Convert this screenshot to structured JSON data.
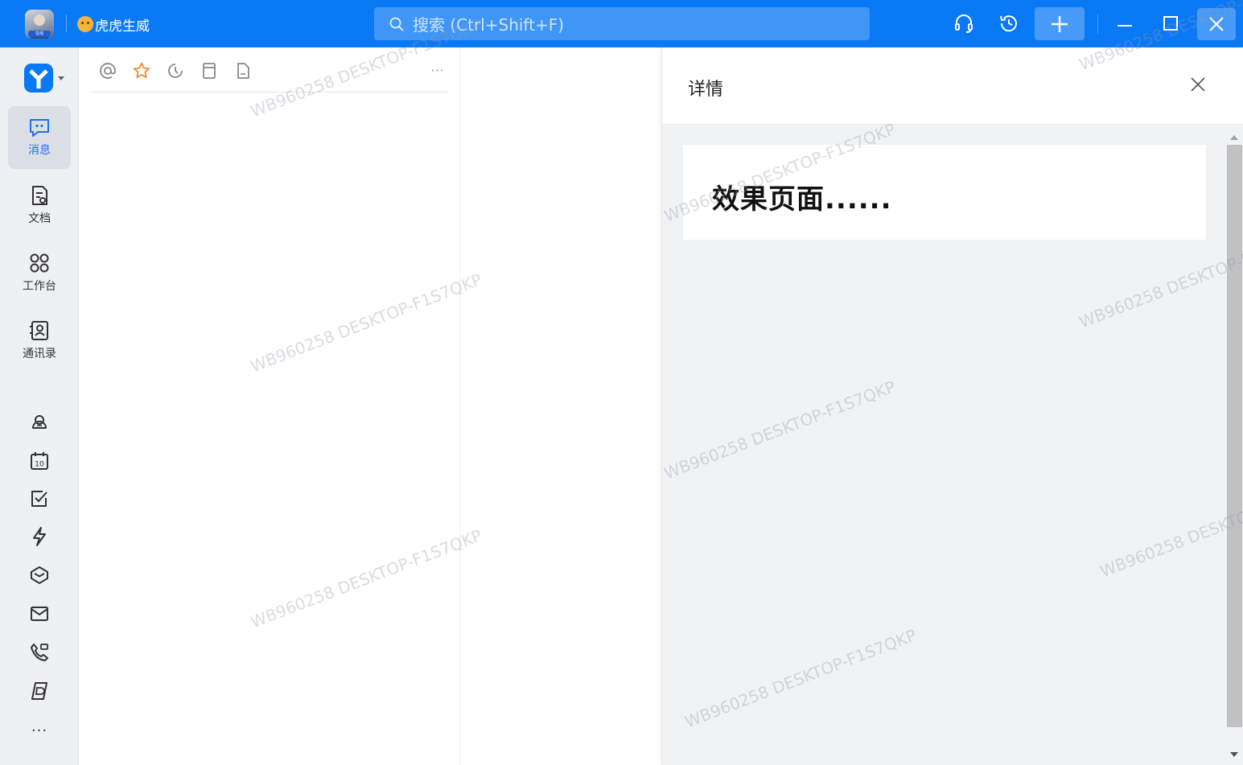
{
  "titlebar": {
    "avatar_badge": "在线",
    "username": "虎虎生威",
    "search_placeholder": "搜索 (Ctrl+Shift+F)"
  },
  "nav": {
    "items": [
      {
        "label": "消息",
        "icon": "message-icon"
      },
      {
        "label": "文档",
        "icon": "document-icon"
      },
      {
        "label": "工作台",
        "icon": "workbench-icon"
      },
      {
        "label": "通讯录",
        "icon": "contacts-icon"
      }
    ],
    "calendar_day": "10",
    "more": "···"
  },
  "list": {
    "more": "···"
  },
  "detail": {
    "title": "详情",
    "content_heading": "效果页面......"
  },
  "watermark": "WB960258 DESKTOP-F1S7QKP",
  "colors": {
    "titlebar": "#0a79f5",
    "accent": "#1a73e8",
    "star": "#f08c2a",
    "nav_bg": "#eef0f3",
    "detail_bg": "#f1f2f4"
  }
}
